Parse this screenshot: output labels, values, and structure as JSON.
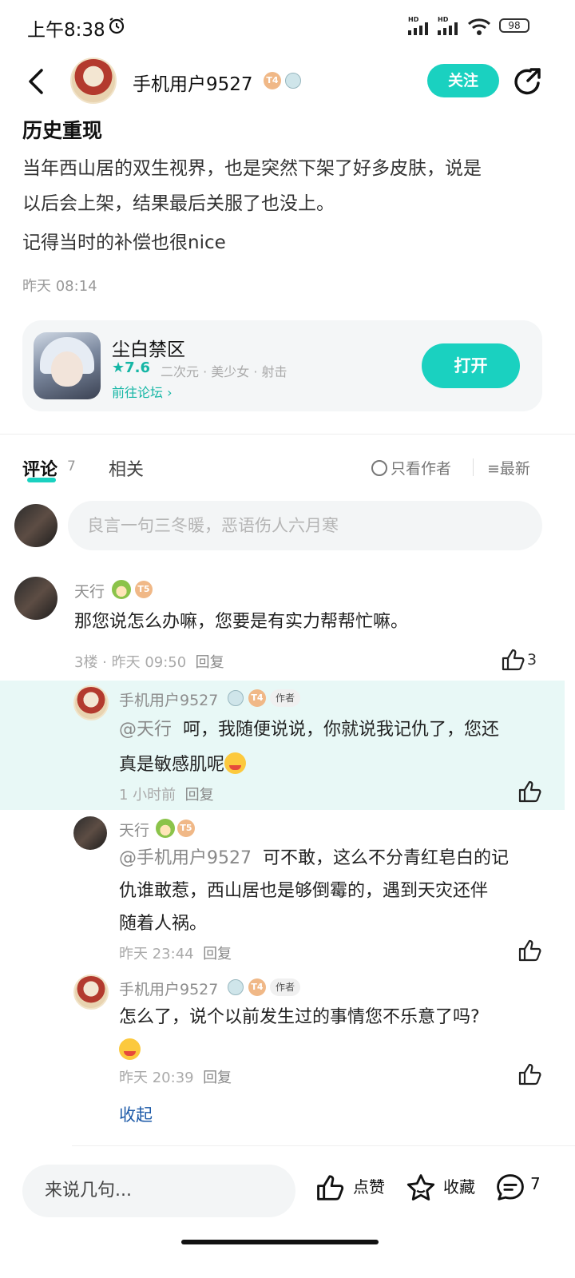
{
  "status_bar": {
    "time": "上午8:38",
    "battery": "98",
    "net1": "HD",
    "net2": "HD"
  },
  "header": {
    "author_name": "手机用户9527",
    "level_badge": "T4",
    "follow_label": "关注"
  },
  "post": {
    "title": "历史重现",
    "body_line1": "当年西山居的双生视界，也是突然下架了好多皮肤，说是",
    "body_line2": "以后会上架，结果最后关服了也没上。",
    "body_line3": "记得当时的补偿也很nice",
    "time": "昨天 08:14"
  },
  "app_card": {
    "name": "尘白禁区",
    "rating": "7.6",
    "tags": "二次元 · 美少女 · 射击",
    "forum_link": "前往论坛",
    "open_label": "打开"
  },
  "tabs": {
    "comments_label": "评论",
    "comments_count": "7",
    "related_label": "相关",
    "only_author_label": "只看作者",
    "sort_label": "最新"
  },
  "comment_input": {
    "placeholder": "良言一句三冬暖，恶语伤人六月寒"
  },
  "comments": [
    {
      "name": "天行",
      "badge": "T5",
      "text": "那您说怎么办嘛，您要是有实力帮帮忙嘛。",
      "meta": "3楼 · 昨天 09:50",
      "reply": "回复",
      "likes": "3"
    }
  ],
  "replies": [
    {
      "name": "手机用户9527",
      "badge": "T4",
      "author_tag": "作者",
      "mention": "@天行",
      "text_line1": "呵，我随便说说，你就说我记仇了，您还",
      "text_line2": "真是敏感肌呢",
      "time": "1 小时前",
      "reply": "回复"
    },
    {
      "name": "天行",
      "badge": "T5",
      "mention": "@手机用户9527",
      "text_line1": "可不敢，这么不分青红皂白的记",
      "text_line2": "仇谁敢惹，西山居也是够倒霉的，遇到天灾还伴",
      "text_line3": "随着人祸。",
      "time": "昨天 23:44",
      "reply": "回复"
    },
    {
      "name": "手机用户9527",
      "badge": "T4",
      "author_tag": "作者",
      "text_line1": "怎么了，说个以前发生过的事情您不乐意了吗?",
      "time": "昨天 20:39",
      "reply": "回复"
    }
  ],
  "collapse_label": "收起",
  "bottom_bar": {
    "input_placeholder": "来说几句...",
    "like_label": "点赞",
    "fav_label": "收藏",
    "comment_count": "7"
  },
  "colors": {
    "accent": "#1ad1c0",
    "highlight_bg": "#e8f8f6",
    "link": "#1d5aa8"
  }
}
